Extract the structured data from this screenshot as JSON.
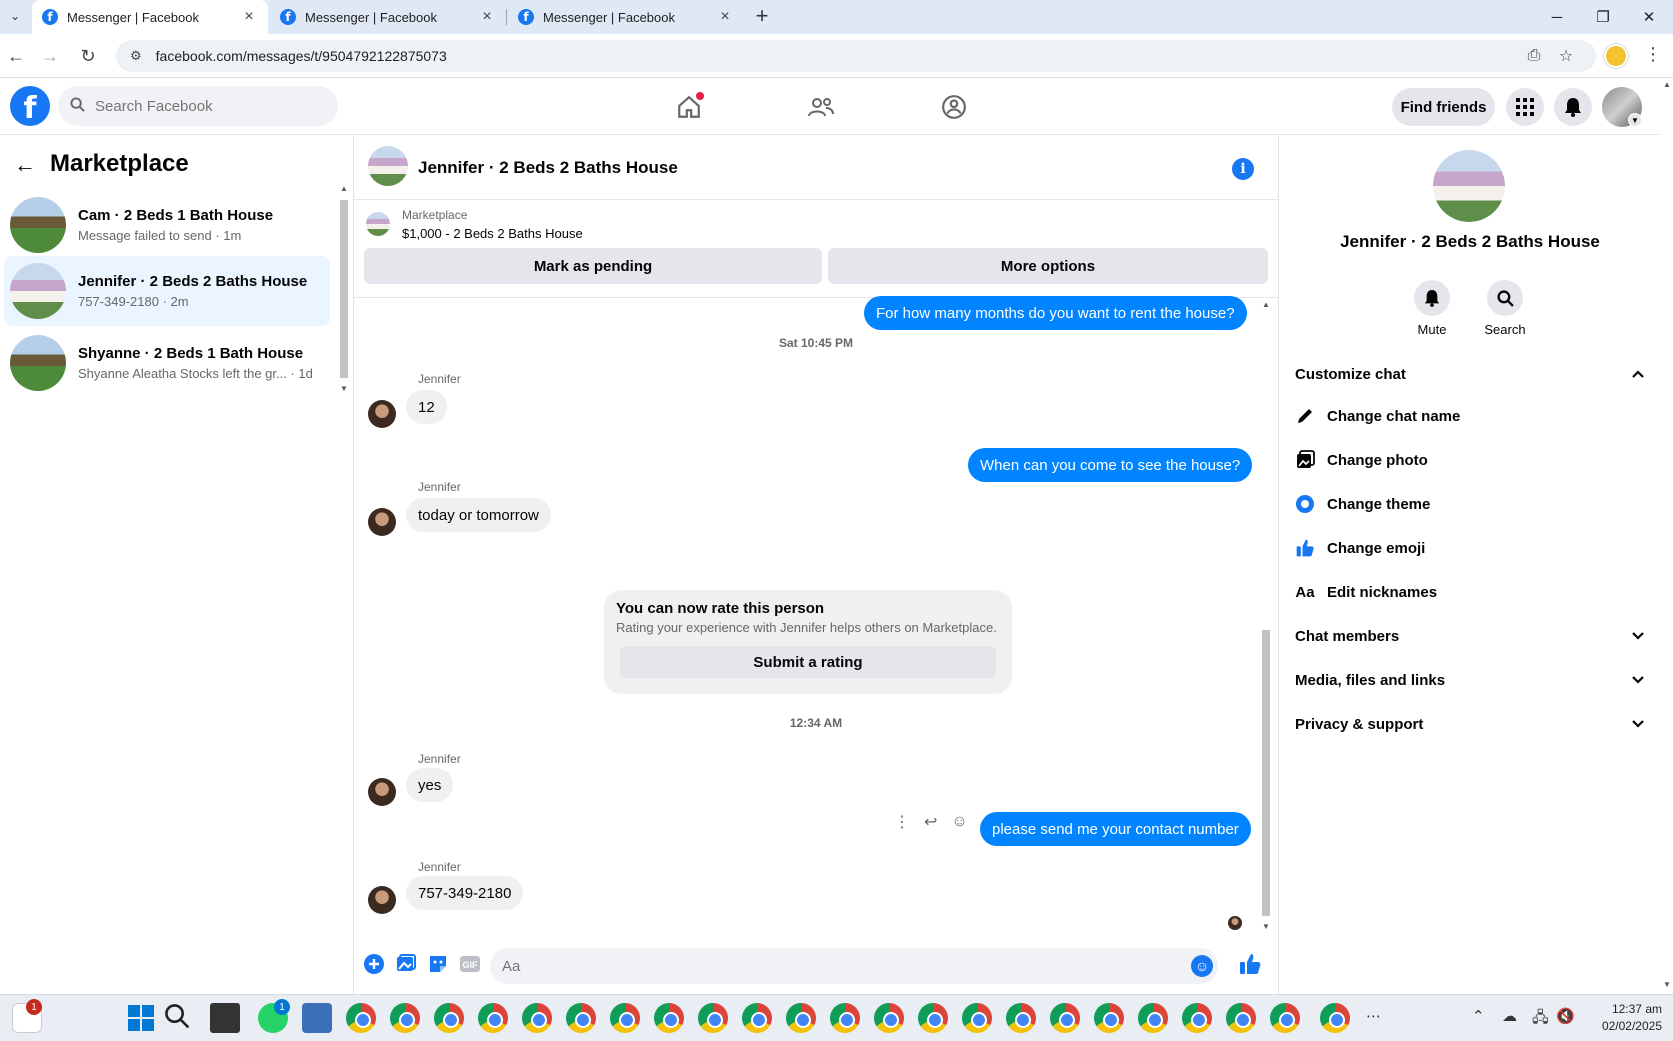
{
  "browser": {
    "tabs": [
      {
        "title": "Messenger | Facebook",
        "active": true
      },
      {
        "title": "Messenger | Facebook",
        "active": false
      },
      {
        "title": "Messenger | Facebook",
        "active": false
      }
    ],
    "url": "facebook.com/messages/t/9504792122875073"
  },
  "fb_header": {
    "logo": "f",
    "search_placeholder": "Search Facebook",
    "find_friends": "Find friends"
  },
  "left": {
    "title": "Marketplace",
    "chats": [
      {
        "name": "Cam · 2 Beds 1 Bath House",
        "sub": "Message failed to send · 1m",
        "selected": false
      },
      {
        "name": "Jennifer · 2 Beds 2 Baths House",
        "sub": "757-349-2180 · 2m",
        "selected": true
      },
      {
        "name": "Shyanne · 2 Beds 1 Bath House",
        "sub": "Shyanne Aleatha Stocks left the gr... · 1d",
        "selected": false
      }
    ]
  },
  "conversation": {
    "title": "Jennifer · 2 Beds 2 Baths House",
    "marketplace_label": "Marketplace",
    "listing": "$1,000 - 2 Beds 2 Baths House",
    "mark_pending": "Mark as pending",
    "more_options": "More options",
    "messages": {
      "m1": "For how many months do you want to rent the house?",
      "ts1": "Sat 10:45 PM",
      "sender": "Jennifer",
      "m2": "12",
      "m3": "When can you come to see the house?",
      "m4": "today or tomorrow",
      "m5": "yes",
      "ts2": "12:34 AM",
      "m6": "please send me your contact number",
      "m7": "757-349-2180"
    },
    "rating": {
      "title": "You can now rate this person",
      "sub": "Rating your experience with Jennifer helps others on Marketplace.",
      "button": "Submit a rating"
    },
    "composer_placeholder": "Aa",
    "gif_label": "GIF"
  },
  "right": {
    "name": "Jennifer · 2 Beds 2 Baths House",
    "mute": "Mute",
    "search": "Search",
    "customize": "Customize chat",
    "items": [
      "Change chat name",
      "Change photo",
      "Change theme",
      "Change emoji",
      "Edit nicknames"
    ],
    "chat_members": "Chat members",
    "media": "Media, files and links",
    "privacy": "Privacy & support",
    "text_icon": "Aa"
  },
  "taskbar": {
    "time": "12:37 am",
    "date": "02/02/2025",
    "badge_left": "1",
    "badge_whatsapp": "1"
  },
  "colors": {
    "fb_blue": "#1877f2",
    "out_bubble": "#0084ff",
    "selected_row": "#ebf5ff"
  }
}
